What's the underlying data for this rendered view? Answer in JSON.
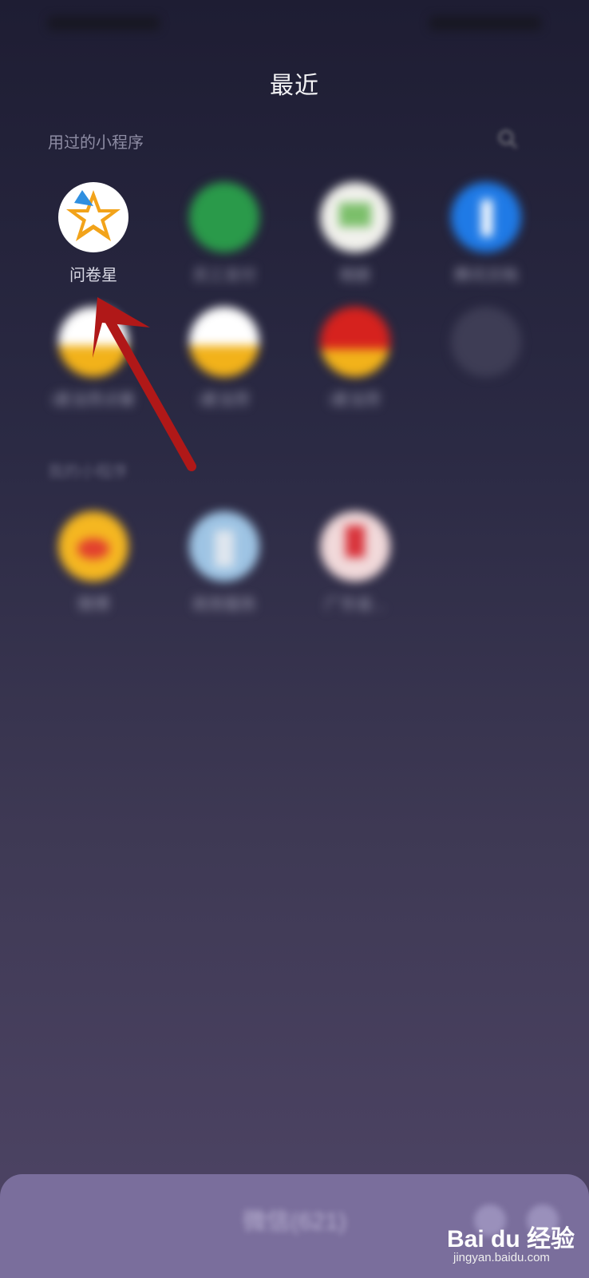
{
  "page": {
    "title": "最近",
    "recent_section_label": "用过的小程序",
    "mine_section_label": "我的小程序"
  },
  "recent_apps": [
    {
      "label": "问卷星",
      "icon": "star-logo-icon"
    },
    {
      "label": "员工支付",
      "icon": "green-leaf-icon"
    },
    {
      "label": "相册",
      "icon": "photo-book-icon"
    },
    {
      "label": "腾讯文档",
      "icon": "blue-arrow-icon"
    },
    {
      "label": "i麦当劳点餐",
      "icon": "mcdonalds-logo-icon"
    },
    {
      "label": "i麦当劳",
      "icon": "mcdonalds-logo-icon"
    },
    {
      "label": "i麦当劳",
      "icon": "mcdonalds-red-logo-icon"
    },
    {
      "label": "",
      "icon": "more-icon"
    }
  ],
  "my_apps": [
    {
      "label": "微博",
      "icon": "weibo-logo-icon"
    },
    {
      "label": "政务服务",
      "icon": "city-icon"
    },
    {
      "label": "广东省...",
      "icon": "red-emblem-icon"
    }
  ],
  "bottom_bar": {
    "title": "微信(621)"
  },
  "watermark": {
    "brand": "Bai du 经验",
    "url": "jingyan.baidu.com"
  },
  "colors": {
    "background_top": "#1e1d33",
    "background_bottom": "#4f4566",
    "bottom_bar": "#7a6e9c",
    "annotation_arrow": "#b01818"
  }
}
